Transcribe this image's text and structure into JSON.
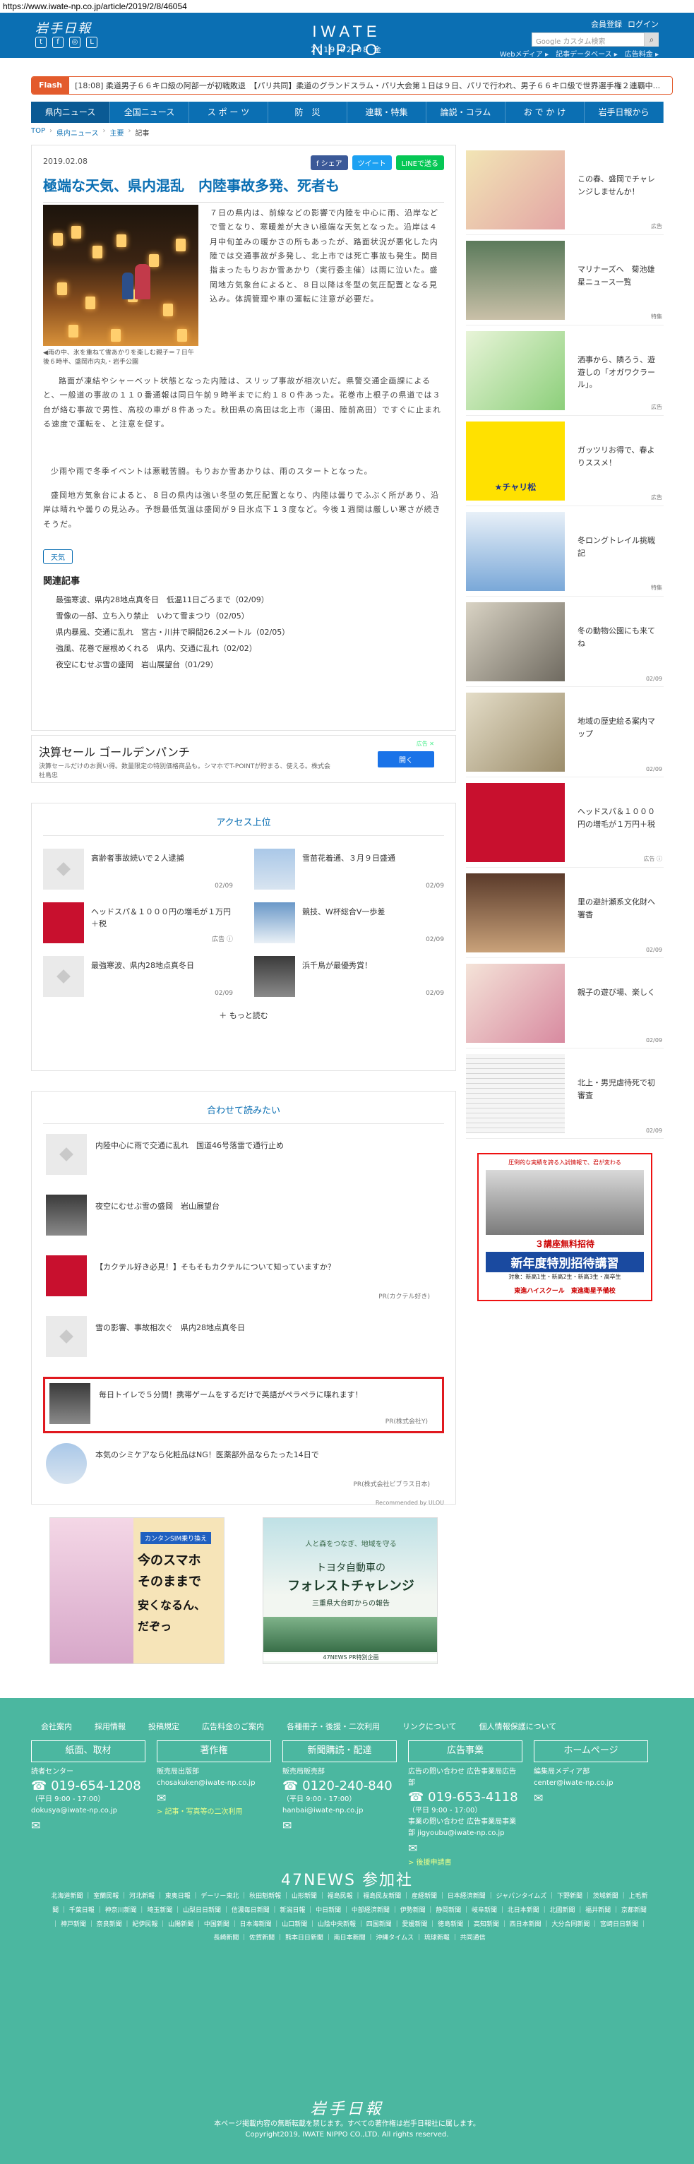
{
  "url": "https://www.iwate-np.co.jp/article/2019/2/8/46054",
  "header": {
    "logo_left": "岩手日報",
    "center_logo": "IWATE NIPPO",
    "date": "2019.02.08 金",
    "member": [
      "会員登録",
      "ログイン"
    ],
    "search_placeholder": "Google カスタム検索",
    "sub_links": [
      "Webメディア ▸",
      "記事データベース ▸",
      "広告料金 ▸"
    ]
  },
  "flash": {
    "tag": "Flash",
    "text": "[18:08] 柔道男子６６キロ級の阿部一が初戦敗退　【パリ共同】柔道のグランドスラム・パリ大会第１日は９日、パリで行われ、男子６６キロ級で世界選手権２連覇中..."
  },
  "nav": [
    "県内ニュース",
    "全国ニュース",
    "ス ポ ー ツ",
    "防　災",
    "連載・特集",
    "論説・コラム",
    "お で か け",
    "岩手日報から"
  ],
  "breadcrumb": [
    "TOP",
    "県内ニュース",
    "主要",
    "記事"
  ],
  "article": {
    "date": "2019.02.08",
    "share": [
      "f シェア",
      "ツイート",
      "LINEで送る"
    ],
    "title": "極端な天気、県内混乱　内陸事故多発、死者も",
    "caption": "◀雨の中、氷を重ねて雪あかりを楽しむ親子＝７日午後６時半、盛岡市内丸・岩手公園",
    "p1": "７日の県内は、前線などの影響で内陸を中心に雨、沿岸などで雪となり、寒暖差が大きい極端な天気となった。沿岸は４月中旬並みの暖かさの所もあったが、路面状況が悪化した内陸では交通事故が多発し、北上市では死亡事故も発生。関目指まったもりおか雪あかり（実行委主催）は雨に泣いた。盛岡地方気象台によると、８日以降は冬型の気圧配置となる見込み。体調管理や車の運転に注意が必要だ。",
    "p2": "路面が凍結やシャーベット状態となった内陸は、スリップ事故が相次いだ。県警交通企画課によると、一般道の事故の１１０番通報は同日午前９時半までに約１８０件あった。花巻市上根子の県道では３台が絡む事故で男性、高校の車が８件あった。秋田県の高田は北上市（湯田、陸前高田）ですぐに止まれる速度で運転を、と注意を促す。",
    "p3": "少雨や雨で冬季イベントは悪戦苦闘。もりおか雪あかりは、雨のスタートとなった。",
    "p4": "盛岡地方気象台によると、８日の県内は強い冬型の気圧配置となり、内陸は曇りでふぶく所があり、沿岸は晴れや曇りの見込み。予想最低気温は盛岡が９日氷点下１３度など。今後１週間は厳しい寒さが続きそうだ。",
    "tag": "天気",
    "related_title": "関連記事",
    "related": [
      "最強寒波、県内28地点真冬日　低温11日ごろまで（02/09）",
      "雪像の一部、立ち入り禁止　いわて雪まつり（02/05）",
      "県内暴風、交通に乱れ　宮古・川井で瞬間26.2メートル（02/05）",
      "強風、花巻で屋根めくれる　県内、交通に乱れ（02/02）",
      "夜空にむせぶ雪の盛岡　岩山展望台（01/29）"
    ]
  },
  "ad": {
    "title": "決算セール ゴールデンパンチ",
    "text": "決算セールだけのお買い得。数量限定の特別価格商品も。シマホでT-POINTが貯まる、使える。株式会社島忠",
    "button": "開く",
    "mark": "広告 ✕"
  },
  "ranking": {
    "title": "アクセス上位",
    "items": [
      {
        "text": "高齢者事故続いで２人逮捕",
        "date": "02/09"
      },
      {
        "text": "雪苗花着通、３月９日盛通",
        "date": "02/09"
      },
      {
        "text": "ヘッドスパ＆１０００円の増毛が１万円＋税",
        "date": "広告 ⓘ"
      },
      {
        "text": "競技、W杯総合V一歩差",
        "date": "02/09"
      },
      {
        "text": "最強寒波、県内28地点真冬日",
        "date": "02/09"
      },
      {
        "text": "浜千鳥が最優秀賞！",
        "date": "02/09"
      }
    ],
    "more": "＋ もっと読む"
  },
  "recommend": {
    "title": "合わせて読みたい",
    "items": [
      {
        "text": "内陸中心に雨で交通に乱れ　国道46号落雷で通行止め",
        "pr": ""
      },
      {
        "text": "夜空にむせぶ雪の盛岡　岩山展望台",
        "pr": ""
      },
      {
        "text": "【カクテル好き必見！】そもそもカクテルについて知っていますか？",
        "pr": "PR(カクテル好き)"
      },
      {
        "text": "雪の影響、事故相次ぐ　県内28地点真冬日",
        "pr": ""
      },
      {
        "text": "毎日トイレで５分間！携帯ゲームをするだけで英語がペラペラに喋れます！",
        "pr": "PR(株式会社Y)"
      },
      {
        "text": "本気のシミケアなら化粧品はNG！医薬部外品ならたった14日で",
        "pr": "PR(株式会社ビブラス日本)"
      }
    ],
    "foot": "Recommended by ULOU"
  },
  "banners": {
    "b1_line1": "カンタンSIM乗り換え",
    "b1_line2": "今のスマホ",
    "b1_line3": "そのままで",
    "b1_line4": "安くなるん、",
    "b1_line5": "だぞっ",
    "b2_line1": "人と森をつなぎ、地域を守る",
    "b2_line2": "トヨタ自動車の",
    "b2_line3": "フォレストチャレンジ",
    "b2_line4": "三重県大台町からの報告",
    "b2_line5": "47NEWS PR特別企画"
  },
  "side": [
    {
      "text": "この春、盛岡でチャレンジしませんか！",
      "date": "広告"
    },
    {
      "text": "マリナーズへ　菊池雄星ニュース一覧",
      "date": "特集"
    },
    {
      "text": "洒事から、隣ろう、遊遊しの「オガワクラール」。",
      "date": "広告"
    },
    {
      "text": "ガッツリお得で、春よりススメ！",
      "date": "広告"
    },
    {
      "text": "冬ロングトレイル挑戦記",
      "date": "特集"
    },
    {
      "text": "冬の動物公園にも来てね",
      "date": "02/09"
    },
    {
      "text": "地域の歴史絵る案内マップ",
      "date": "02/09"
    },
    {
      "text": "ヘッドスパ＆１０００円の増毛が１万円＋税",
      "date": "広告 ⓘ"
    },
    {
      "text": "里の避計瀬系文化財へ署香",
      "date": "02/09"
    },
    {
      "text": "親子の遊び場、楽しく",
      "date": "02/09"
    },
    {
      "text": "北上・男児虐待死で初審査",
      "date": "02/09"
    }
  ],
  "side_banner": {
    "l1": "圧倒的な実績を誇る入試情報で、君が変わる",
    "l2": "３講座無料招待",
    "l3": "新年度特別招待講習",
    "l4": "対象：新高1生・新高2生・新高3生・高卒生",
    "l5": "東進ハイスクール　東進衛星予備校"
  },
  "footer": {
    "links": [
      "会社案内",
      "採用情報",
      "投稿規定",
      "広告料金のご案内",
      "各種冊子・後援・二次利用",
      "リンクについて",
      "個人情報保護について"
    ],
    "cols": [
      {
        "box": "紙面、取材",
        "label": "読者センター",
        "phone": "☎ 019-654-1208",
        "hours": "（平日 9:00 - 17:00）",
        "mail": "dokusya@iwate-np.co.jp",
        "extra": ""
      },
      {
        "box": "著作権",
        "label": "販売局出版部",
        "phone": "",
        "hours": "",
        "mail": "chosakuken@iwate-np.co.jp",
        "extra": "> 記事・写真等の二次利用"
      },
      {
        "box": "新聞購読・配達",
        "label": "販売局販売部",
        "phone": "☎ 0120-240-840",
        "hours": "（平日 9:00 - 17:00）",
        "mail": "hanbai@iwate-np.co.jp",
        "extra": ""
      },
      {
        "box": "広告事業",
        "label": "広告の問い合わせ 広告事業局広告部",
        "phone": "☎ 019-653-4118",
        "hours": "（平日 9:00 - 17:00）",
        "mail": "事業の問い合わせ 広告事業局事業部 jigyoubu@iwate-np.co.jp",
        "extra": "> 後援申請書"
      },
      {
        "box": "ホームページ",
        "label": "編集局メディア部",
        "phone": "",
        "hours": "",
        "mail": "center@iwate-np.co.jp",
        "extra": ""
      }
    ],
    "news47": "47NEWS 参加社",
    "papers": "北海道新聞 ｜ 室蘭民報 ｜ 河北新報 ｜ 東奥日報 ｜ デーリー東北 ｜ 秋田魁新報 ｜ 山形新聞 ｜ 福島民報 ｜ 福島民友新聞 ｜ 産経新聞 ｜ 日本経済新聞 ｜ ジャパンタイムズ ｜ 下野新聞 ｜ 茨城新聞 ｜ 上毛新聞 ｜ 千葉日報 ｜ 神奈川新聞 ｜ 埼玉新聞 ｜ 山梨日日新聞 ｜ 信濃毎日新聞 ｜ 新潟日報 ｜ 中日新聞 ｜ 中部経済新聞 ｜ 伊勢新聞 ｜ 静岡新聞 ｜ 岐阜新聞 ｜ 北日本新聞 ｜ 北國新聞 ｜ 福井新聞 ｜ 京都新聞 ｜ 神戸新聞 ｜ 奈良新聞 ｜ 紀伊民報 ｜ 山陽新聞 ｜ 中国新聞 ｜ 日本海新聞 ｜ 山口新聞 ｜ 山陰中央新報 ｜ 四国新聞 ｜ 愛媛新聞 ｜ 徳島新聞 ｜ 高知新聞 ｜ 西日本新聞 ｜ 大分合同新聞 ｜ 宮崎日日新聞 ｜ 長崎新聞 ｜ 佐賀新聞 ｜ 熊本日日新聞 ｜ 南日本新聞 ｜ 沖縄タイムス ｜ 琉球新報 ｜ 共同通信",
    "logo": "岩手日報",
    "copy1": "本ページ掲載内容の無断転載を禁じます。すべての著作権は岩手日報社に属します。",
    "copy2": "Copyright2019, IWATE NIPPO CO.,LTD. All rights reserved."
  }
}
